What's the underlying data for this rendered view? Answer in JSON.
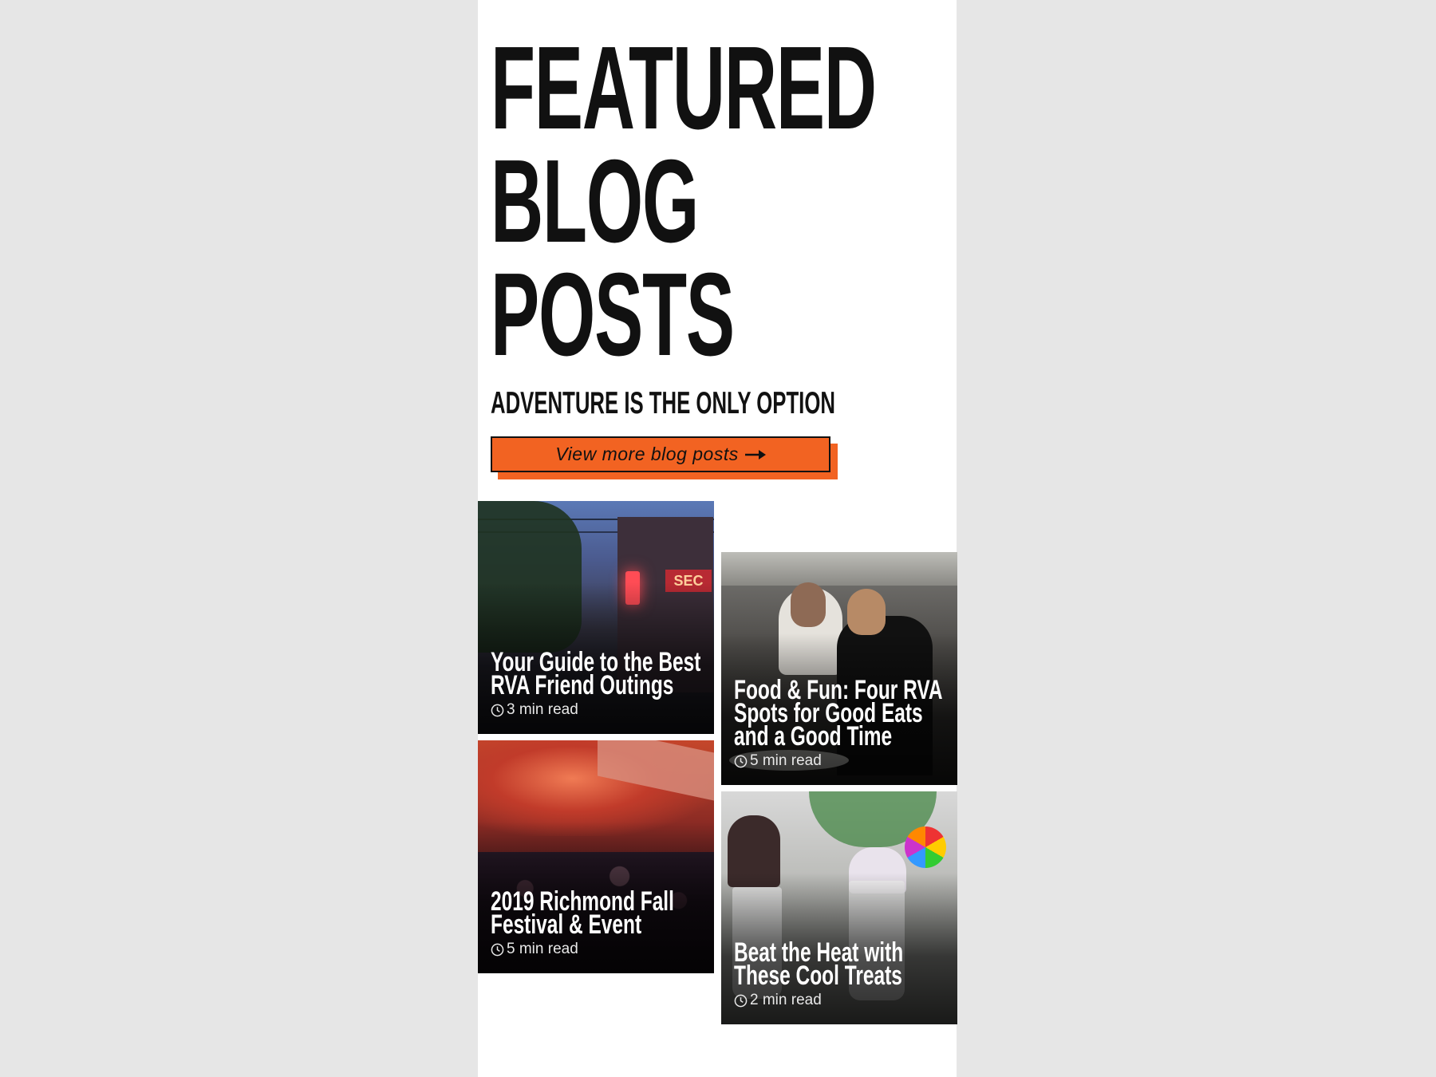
{
  "section": {
    "title_lines": [
      "FEATURED",
      "BLOG",
      "POSTS"
    ],
    "subtitle": "ADVENTURE IS THE ONLY OPTION",
    "cta_label": "View more blog posts",
    "accent_color": "#f26322"
  },
  "posts": [
    {
      "title": "Your Guide to the Best RVA Friend Outings",
      "read_time": "3 min read"
    },
    {
      "title": "Food & Fun: Four RVA Spots for Good Eats and a Good Time",
      "read_time": "5 min read"
    },
    {
      "title": "2019 Richmond Fall Festival & Event",
      "read_time": "5 min read"
    },
    {
      "title": "Beat the Heat with These Cool Treats",
      "read_time": "2 min read"
    }
  ],
  "icons": {
    "cta_arrow": "arrow-right-icon",
    "read_time": "clock-icon"
  }
}
